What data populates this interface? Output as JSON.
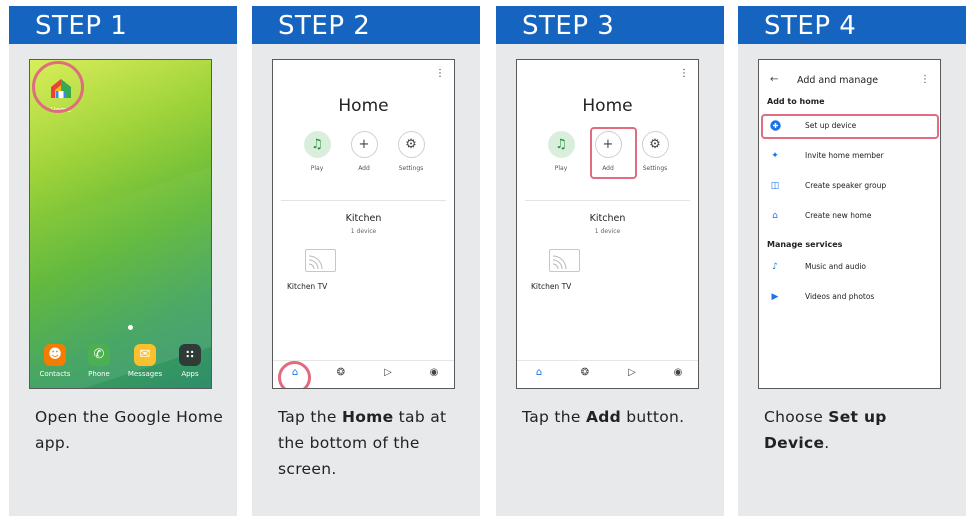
{
  "steps": [
    {
      "title": "STEP 1",
      "desc_parts": [
        "Open the Google Home app."
      ],
      "home_app_label": "Home",
      "dock": [
        {
          "label": "Contacts",
          "icon": "contacts-icon",
          "color": "#f57c00"
        },
        {
          "label": "Phone",
          "icon": "phone-icon",
          "color": "#4caf50"
        },
        {
          "label": "Messages",
          "icon": "messages-icon",
          "color": "#fbc02d"
        },
        {
          "label": "Apps",
          "icon": "apps-icon",
          "color": "#2e3b36"
        }
      ]
    },
    {
      "title": "STEP 2",
      "desc_pre": "Tap the ",
      "desc_bold": "Home",
      "desc_post": " tab at the bottom of the screen."
    },
    {
      "title": "STEP 3",
      "desc_pre": "Tap the ",
      "desc_bold": "Add",
      "desc_post": " button."
    },
    {
      "title": "STEP 4",
      "desc_pre": "Choose ",
      "desc_bold": "Set up Device",
      "desc_post": "."
    }
  ],
  "home_screen": {
    "title": "Home",
    "actions": [
      "Play",
      "Add",
      "Settings"
    ],
    "room": "Kitchen",
    "room_sub": "1 device",
    "device": "Kitchen TV"
  },
  "add_manage": {
    "title": "Add and manage",
    "section1": "Add to home",
    "items1": [
      "Set up device",
      "Invite home member",
      "Create speaker group",
      "Create new home"
    ],
    "section2": "Manage services",
    "items2": [
      "Music and audio",
      "Videos and photos"
    ]
  },
  "colors": {
    "header": "#1565c0",
    "highlight": "#e06c80",
    "accent": "#1a73e8"
  }
}
